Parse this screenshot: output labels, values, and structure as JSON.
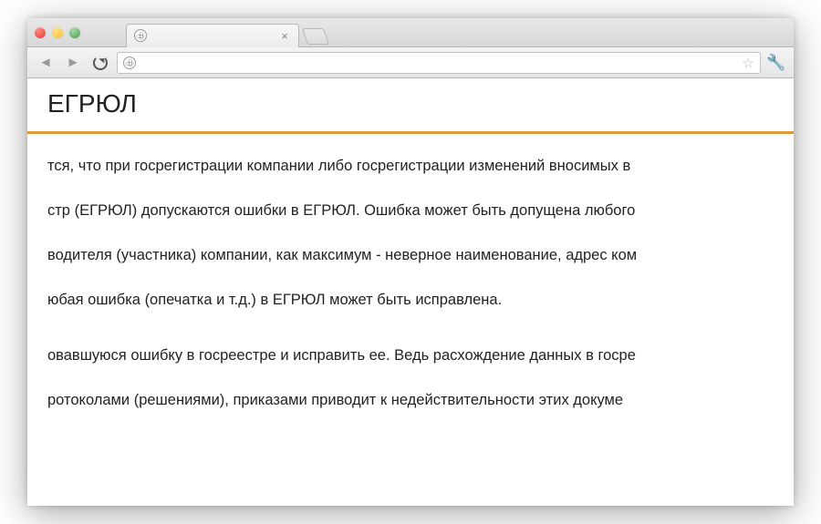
{
  "browser": {
    "tab": {
      "title": "",
      "close_glyph": "×"
    },
    "omnibox": {
      "url": "",
      "placeholder": ""
    },
    "icons": {
      "star": "☆",
      "wrench": "🔧",
      "back": "◄",
      "forward": "►"
    }
  },
  "page": {
    "heading": "ЕГРЮЛ",
    "divider_color": "#e19a3a",
    "lines": [
      "тся, что при госрегистрации компании либо госрегистрации изменений вносимых в",
      "стр (ЕГРЮЛ) допускаются ошибки в ЕГРЮЛ. Ошибка может быть допущена любого",
      "водителя (участника) компании, как максимум - неверное наименование, адрес ком",
      "юбая ошибка (опечатка и т.д.) в ЕГРЮЛ может быть исправлена.",
      "овавшуюся ошибку в госреестре и исправить ее. Ведь расхождение данных в госре",
      "ротоколами (решениями), приказами приводит к недействительности этих докуме"
    ]
  }
}
